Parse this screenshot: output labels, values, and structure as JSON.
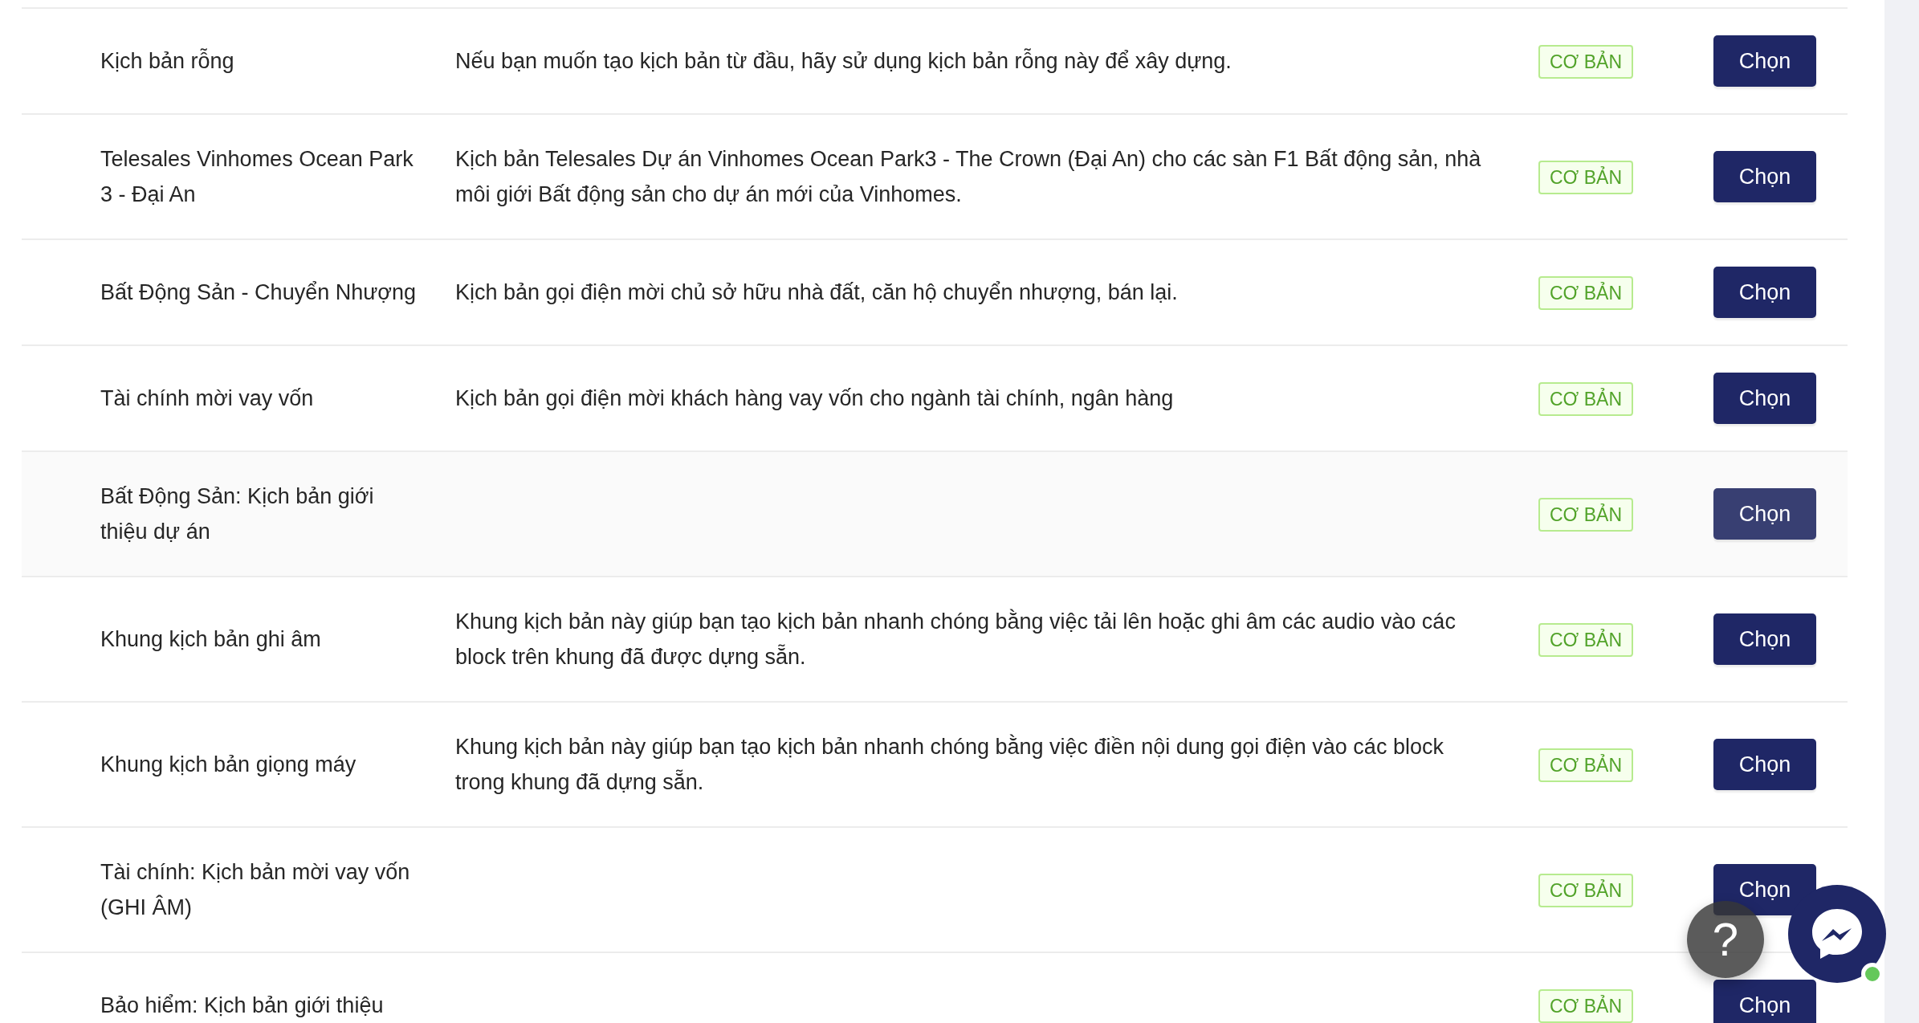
{
  "templates": [
    {
      "name": "Kịch bản rỗng",
      "description": "Nếu bạn muốn tạo kịch bản từ đầu, hãy sử dụng kịch bản rỗng này để xây dựng.",
      "badge": "CƠ BẢN",
      "button": "Chọn",
      "highlighted": false
    },
    {
      "name": "Telesales Vinhomes Ocean Park 3 - Đại An",
      "description": "Kịch bản Telesales Dự án Vinhomes Ocean Park3 - The Crown (Đại An) cho các sàn F1 Bất động sản, nhà môi giới Bất động sản cho dự án mới của Vinhomes.",
      "badge": "CƠ BẢN",
      "button": "Chọn",
      "highlighted": false
    },
    {
      "name": "Bất Động Sản - Chuyển Nhượng",
      "description": "Kịch bản gọi điện mời chủ sở hữu nhà đất, căn hộ chuyển nhượng, bán lại.",
      "badge": "CƠ BẢN",
      "button": "Chọn",
      "highlighted": false
    },
    {
      "name": "Tài chính mời vay vốn",
      "description": "Kịch bản gọi điện mời khách hàng vay vốn cho ngành tài chính, ngân hàng",
      "badge": "CƠ BẢN",
      "button": "Chọn",
      "highlighted": false
    },
    {
      "name": "Bất Động Sản: Kịch bản giới thiệu dự án",
      "badge": "CƠ BẢN",
      "button": "Chọn",
      "highlighted": true
    },
    {
      "name": "Khung kịch bản ghi âm",
      "description": "Khung kịch bản này giúp bạn tạo kịch bản nhanh chóng bằng việc tải lên hoặc ghi âm các audio vào các block trên khung đã được dựng sẵn.",
      "badge": "CƠ BẢN",
      "button": "Chọn",
      "highlighted": false
    },
    {
      "name": "Khung kịch bản giọng máy",
      "description": "Khung kịch bản này giúp bạn tạo kịch bản nhanh chóng bằng việc điền nội dung gọi điện vào các block trong khung đã dựng sẵn.",
      "badge": "CƠ BẢN",
      "button": "Chọn",
      "highlighted": false
    },
    {
      "name": "Tài chính: Kịch bản mời vay vốn (GHI ÂM)",
      "badge": "CƠ BẢN",
      "button": "Chọn",
      "highlighted": false
    },
    {
      "name": "Bảo hiểm: Kịch bản giới thiệu",
      "badge": "CƠ BẢN",
      "button": "Chọn",
      "highlighted": false
    }
  ],
  "help_button": {
    "label": "?"
  },
  "messenger": {
    "online": true
  }
}
